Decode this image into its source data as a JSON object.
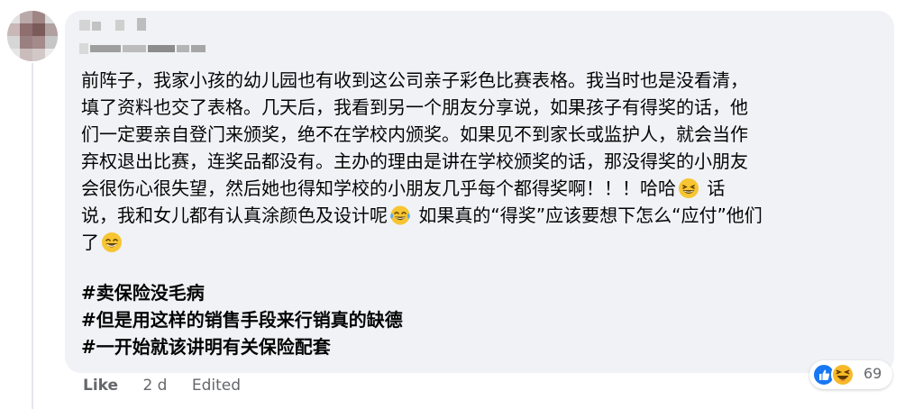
{
  "comment": {
    "lines": [
      "前阵子，我家小孩的幼儿园也有收到这公司亲子彩色比赛表格。我当时也是没看清，",
      "填了资料也交了表格。几天后，我看到另一个朋友分享说，如果孩子有得奖的话，他",
      "们一定要亲自登门来颁奖，绝不在学校内颁奖。如果见不到家长或监护人，就会当作",
      "弃权退出比赛，连奖品都没有。主办的理由是讲在学校颁奖的话，那没得奖的小朋友",
      "会很伤心很失望，然后她也得知学校的小朋友几乎每个都得奖啊！！！哈哈",
      "话",
      "说，我和女儿都有认真涂颜色及设计呢",
      "如果真的“得奖”应该要想下怎么“应付”他们",
      "了"
    ],
    "emojis": [
      "grinning-squint-emoji",
      "tears-of-joy-emoji",
      "beaming-grin-emoji"
    ],
    "hashtags": [
      "#卖保险没毛病",
      "#但是用这样的销售手段来行销真的缺德",
      "#一开始就该讲明有关保险配套"
    ]
  },
  "reactions": {
    "icons": [
      "like-reaction-icon",
      "haha-reaction-icon"
    ],
    "count": "69",
    "colors": {
      "like": "#1877f2",
      "haha": "#f7b928"
    }
  },
  "actions": {
    "like_label": "Like",
    "time_label": "2 d",
    "edited_label": "Edited"
  },
  "colors": {
    "bubble_background": "#f0f2f5",
    "text": "#050505",
    "meta_text": "#65676b"
  }
}
